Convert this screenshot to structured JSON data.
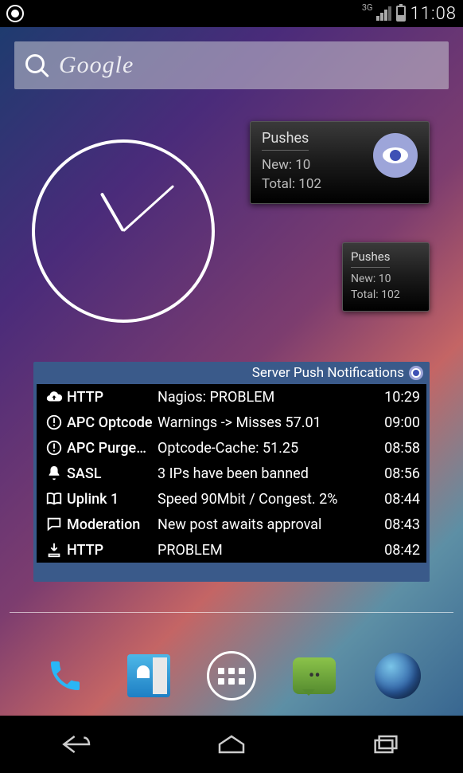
{
  "status": {
    "network": "3G",
    "time": "11:08"
  },
  "search": {
    "placeholder": "Google"
  },
  "pushes_large": {
    "title": "Pushes",
    "new_label": "New: 10",
    "total_label": "Total: 102"
  },
  "pushes_small": {
    "title": "Pushes",
    "new_label": "New: 10",
    "total_label": "Total: 102"
  },
  "server_widget": {
    "title": "Server Push Notifications",
    "rows": [
      {
        "icon": "cloud-up",
        "label": "HTTP",
        "msg": "Nagios: PROBLEM",
        "time": "10:29"
      },
      {
        "icon": "alert",
        "label": "APC Optcode",
        "msg": "Warnings -> Misses 57.01",
        "time": "09:00"
      },
      {
        "icon": "alert",
        "label": "APC Purge…",
        "msg": "Optcode-Cache: 51.25",
        "time": "08:58"
      },
      {
        "icon": "bell",
        "label": "SASL",
        "msg": "3 IPs have been banned",
        "time": "08:56"
      },
      {
        "icon": "book",
        "label": "Uplink 1",
        "msg": "Speed 90Mbit / Congest. 2%",
        "time": "08:44"
      },
      {
        "icon": "chat",
        "label": "Moderation",
        "msg": "New post awaits approval",
        "time": "08:43"
      },
      {
        "icon": "download",
        "label": "HTTP",
        "msg": "PROBLEM",
        "time": "08:42"
      }
    ]
  }
}
